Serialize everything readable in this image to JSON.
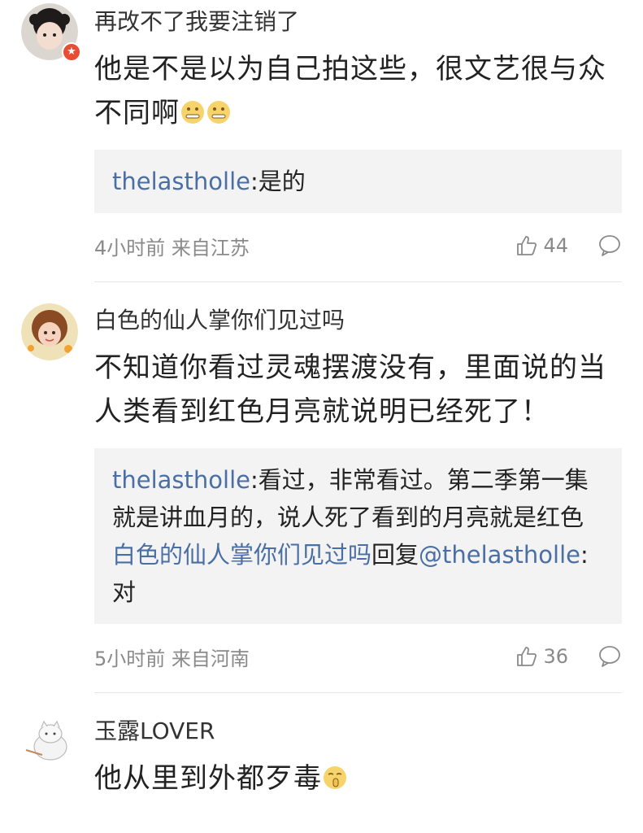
{
  "comments": [
    {
      "username": "再改不了我要注销了",
      "content": "他是不是以为自己拍这些，很文艺很与众不同啊",
      "replies": [
        {
          "user": "thelastholle",
          "sep": ":",
          "text": "是的"
        }
      ],
      "time": "4小时前 来自江苏",
      "likes": "44",
      "badge_icon": "star-badge"
    },
    {
      "username": "白色的仙人掌你们见过吗",
      "content": "不知道你看过灵魂摆渡没有，里面说的当人类看到红色月亮就说明已经死了！",
      "replies": [
        {
          "user": "thelastholle",
          "sep": ":",
          "text": "看过，非常看过。第二季第一集就是讲血月的，说人死了看到的月亮就是红色"
        },
        {
          "user": "白色的仙人掌你们见过吗",
          "mid": "回复",
          "target": "@thelastholle",
          "sep": ":",
          "text": "对"
        }
      ],
      "time": "5小时前 来自河南",
      "likes": "36"
    },
    {
      "username": "玉露LOVER",
      "content": "他从里到外都歹毒"
    }
  ],
  "colors": {
    "link": "#4a6fa5",
    "meta": "#8a8a8a",
    "reply_bg": "#f3f3f3",
    "badge": "#e94b35"
  },
  "icons": {
    "like": "thumbs-up-icon",
    "reply": "comment-bubble-icon",
    "emoji_1": "mouth-zipped-emoji",
    "emoji_2": "shush-emoji"
  }
}
